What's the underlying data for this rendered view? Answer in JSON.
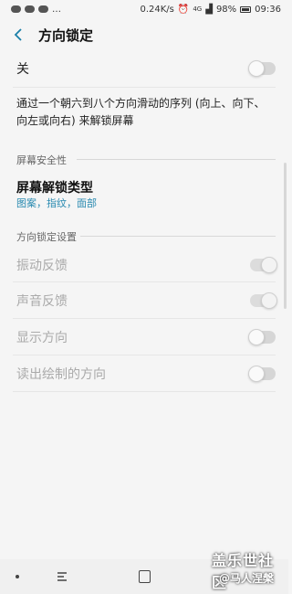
{
  "status_bar": {
    "speed": "0.24K/s",
    "network": "4G",
    "battery": "98%",
    "time": "09:36"
  },
  "header": {
    "title": "方向锁定"
  },
  "master_toggle": {
    "label": "关",
    "state": "off"
  },
  "description": "通过一个朝六到八个方向滑动的序列 (向上、向下、向左或向右) 来解锁屏幕",
  "security_section": {
    "header": "屏幕安全性",
    "item_title": "屏幕解锁类型",
    "item_subtitle": "图案，指纹，面部"
  },
  "settings_section": {
    "header": "方向锁定设置",
    "items": [
      {
        "label": "振动反馈",
        "state": "on"
      },
      {
        "label": "声音反馈",
        "state": "on"
      },
      {
        "label": "显示方向",
        "state": "off"
      },
      {
        "label": "读出绘制的方向",
        "state": "off"
      }
    ]
  },
  "watermark": {
    "line1": "盖乐世社区",
    "line2": "@马人涅槃"
  },
  "icons": [
    "back-arrow-icon",
    "wechat-icon",
    "alarm-icon",
    "signal-icon",
    "battery-icon",
    "recent-apps-icon",
    "home-icon",
    "nav-dot-icon"
  ]
}
